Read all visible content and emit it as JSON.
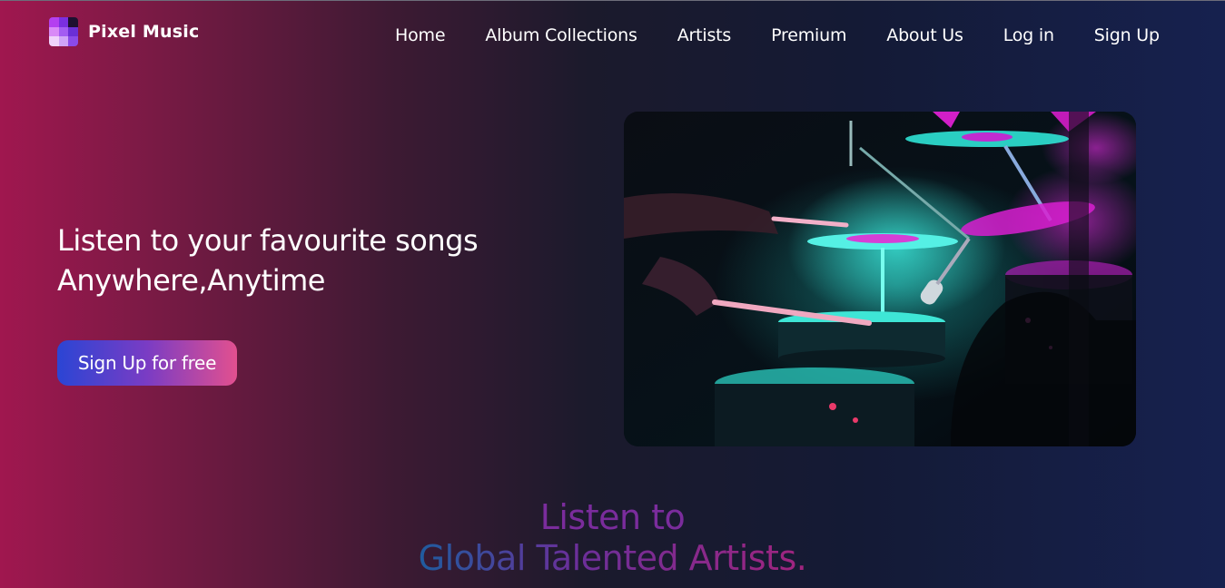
{
  "brand": {
    "name": "Pixel Music"
  },
  "nav": {
    "items": [
      "Home",
      "Album Collections",
      "Artists",
      "Premium",
      "About Us",
      "Log in",
      "Sign Up"
    ]
  },
  "hero": {
    "title_line1": "Listen to your favourite songs",
    "title_line2": "Anywhere,Anytime",
    "cta_label": "Sign Up for free",
    "image_subject": "drummer playing a drum kit under teal and magenta stage lights"
  },
  "section": {
    "heading_line1": "Listen to",
    "heading_line2": "Global Talented Artists."
  },
  "colors": {
    "background_left": "#a0174f",
    "background_right": "#16214f",
    "cta_gradient": [
      "#2b45d4",
      "#7a3cc4",
      "#e2508f"
    ],
    "heading_gradient": [
      "#1f5c9e",
      "#6a2f9a",
      "#a1247e"
    ],
    "image_accent_teal": "#2fe3d5",
    "image_accent_magenta": "#d81fd0"
  }
}
